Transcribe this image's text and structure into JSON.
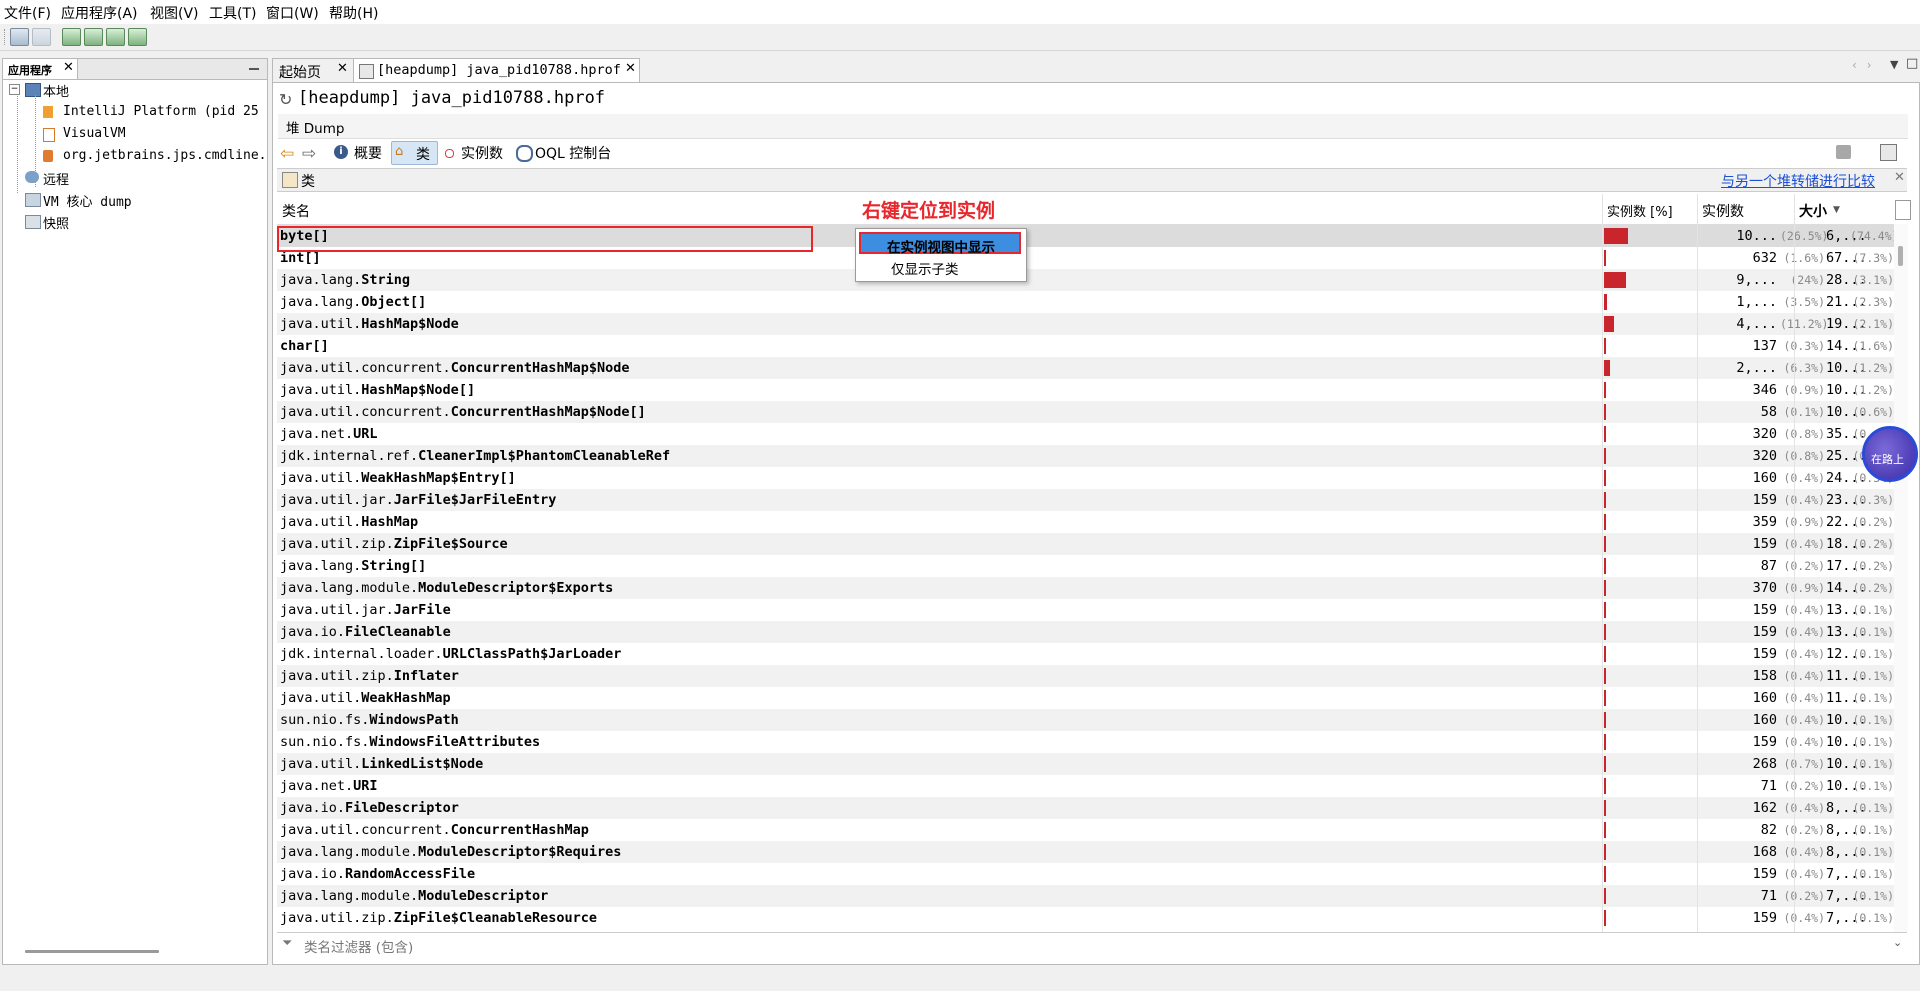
{
  "menu": [
    "文件(F)",
    "应用程序(A)",
    "视图(V)",
    "工具(T)",
    "窗口(W)",
    "帮助(H)"
  ],
  "left_panel": {
    "tab_label": "应用程序",
    "tree": {
      "local": "本地",
      "local_items": [
        "IntelliJ Platform (pid 25",
        "VisualVM",
        "org.jetbrains.jps.cmdline."
      ],
      "remote": "远程",
      "vm_core": "VM 核心 dump",
      "snapshots": "快照"
    }
  },
  "doc_tabs": [
    "起始页",
    "[heapdump] java_pid10788.hprof"
  ],
  "main": {
    "title": "[heapdump] java_pid10788.hprof",
    "heap_label": "堆 Dump",
    "nav": {
      "summary": "概要",
      "classes": "类",
      "instances": "实例数",
      "oql": "OQL 控制台"
    },
    "section_title": "类",
    "compare_link": "与另一个堆转储进行比较",
    "columns": {
      "class_name": "类名",
      "instances_pct": "实例数 [%]",
      "instances": "实例数",
      "size": "大小"
    },
    "filter_placeholder": "类名过滤器 (包含)"
  },
  "annotation": "右键定位到实例",
  "context_menu": {
    "item1": "在实例视图中显示",
    "item2": "仅显示子类"
  },
  "overlay_badge": "在路上",
  "colors": {
    "bar": "#c8262c",
    "annotation": "#e8262c",
    "selection": "#3d8ee0",
    "link": "#1a4fd6"
  },
  "rows": [
    {
      "pkg": "",
      "name": "byte[]",
      "pct_bar": 0.265,
      "count": "10...",
      "count_pct": "(26.5%)",
      "size": "6,...",
      "size_pct": "(74.4%)"
    },
    {
      "pkg": "",
      "name": "int[]",
      "pct_bar": 0.016,
      "count": "632",
      "count_pct": "(1.6%)",
      "size": "67...",
      "size_pct": "(7.3%)"
    },
    {
      "pkg": "java.lang.",
      "name": "String",
      "pct_bar": 0.24,
      "count": "9,...",
      "count_pct": "(24%)",
      "size": "28...",
      "size_pct": "(3.1%)"
    },
    {
      "pkg": "java.lang.",
      "name": "Object[]",
      "pct_bar": 0.035,
      "count": "1,...",
      "count_pct": "(3.5%)",
      "size": "21...",
      "size_pct": "(2.3%)"
    },
    {
      "pkg": "java.util.",
      "name": "HashMap$Node",
      "pct_bar": 0.112,
      "count": "4,...",
      "count_pct": "(11.2%)",
      "size": "19...",
      "size_pct": "(2.1%)"
    },
    {
      "pkg": "",
      "name": "char[]",
      "pct_bar": 0.003,
      "count": "137",
      "count_pct": "(0.3%)",
      "size": "14...",
      "size_pct": "(1.6%)"
    },
    {
      "pkg": "java.util.concurrent.",
      "name": "ConcurrentHashMap$Node",
      "pct_bar": 0.063,
      "count": "2,...",
      "count_pct": "(6.3%)",
      "size": "10...",
      "size_pct": "(1.2%)"
    },
    {
      "pkg": "java.util.",
      "name": "HashMap$Node[]",
      "pct_bar": 0.009,
      "count": "346",
      "count_pct": "(0.9%)",
      "size": "10...",
      "size_pct": "(1.2%)"
    },
    {
      "pkg": "java.util.concurrent.",
      "name": "ConcurrentHashMap$Node[]",
      "pct_bar": 0.001,
      "count": "58",
      "count_pct": "(0.1%)",
      "size": "10...",
      "size_pct": "(0.6%)"
    },
    {
      "pkg": "java.net.",
      "name": "URL",
      "pct_bar": 0.008,
      "count": "320",
      "count_pct": "(0.8%)",
      "size": "35...",
      "size_pct": "(0.4%)"
    },
    {
      "pkg": "jdk.internal.ref.",
      "name": "CleanerImpl$PhantomCleanableRef",
      "pct_bar": 0.008,
      "count": "320",
      "count_pct": "(0.8%)",
      "size": "25...",
      "size_pct": "(0.3%)"
    },
    {
      "pkg": "java.util.",
      "name": "WeakHashMap$Entry[]",
      "pct_bar": 0.004,
      "count": "160",
      "count_pct": "(0.4%)",
      "size": "24...",
      "size_pct": "(0.3%)"
    },
    {
      "pkg": "java.util.jar.",
      "name": "JarFile$JarFileEntry",
      "pct_bar": 0.004,
      "count": "159",
      "count_pct": "(0.4%)",
      "size": "23...",
      "size_pct": "(0.3%)"
    },
    {
      "pkg": "java.util.",
      "name": "HashMap",
      "pct_bar": 0.009,
      "count": "359",
      "count_pct": "(0.9%)",
      "size": "22...",
      "size_pct": "(0.2%)"
    },
    {
      "pkg": "java.util.zip.",
      "name": "ZipFile$Source",
      "pct_bar": 0.004,
      "count": "159",
      "count_pct": "(0.4%)",
      "size": "18...",
      "size_pct": "(0.2%)"
    },
    {
      "pkg": "java.lang.",
      "name": "String[]",
      "pct_bar": 0.002,
      "count": "87",
      "count_pct": "(0.2%)",
      "size": "17...",
      "size_pct": "(0.2%)"
    },
    {
      "pkg": "java.lang.module.",
      "name": "ModuleDescriptor$Exports",
      "pct_bar": 0.009,
      "count": "370",
      "count_pct": "(0.9%)",
      "size": "14...",
      "size_pct": "(0.2%)"
    },
    {
      "pkg": "java.util.jar.",
      "name": "JarFile",
      "pct_bar": 0.004,
      "count": "159",
      "count_pct": "(0.4%)",
      "size": "13...",
      "size_pct": "(0.1%)"
    },
    {
      "pkg": "java.io.",
      "name": "FileCleanable",
      "pct_bar": 0.004,
      "count": "159",
      "count_pct": "(0.4%)",
      "size": "13...",
      "size_pct": "(0.1%)"
    },
    {
      "pkg": "jdk.internal.loader.",
      "name": "URLClassPath$JarLoader",
      "pct_bar": 0.004,
      "count": "159",
      "count_pct": "(0.4%)",
      "size": "12...",
      "size_pct": "(0.1%)"
    },
    {
      "pkg": "java.util.zip.",
      "name": "Inflater",
      "pct_bar": 0.004,
      "count": "158",
      "count_pct": "(0.4%)",
      "size": "11...",
      "size_pct": "(0.1%)"
    },
    {
      "pkg": "java.util.",
      "name": "WeakHashMap",
      "pct_bar": 0.004,
      "count": "160",
      "count_pct": "(0.4%)",
      "size": "11...",
      "size_pct": "(0.1%)"
    },
    {
      "pkg": "sun.nio.fs.",
      "name": "WindowsPath",
      "pct_bar": 0.004,
      "count": "160",
      "count_pct": "(0.4%)",
      "size": "10...",
      "size_pct": "(0.1%)"
    },
    {
      "pkg": "sun.nio.fs.",
      "name": "WindowsFileAttributes",
      "pct_bar": 0.004,
      "count": "159",
      "count_pct": "(0.4%)",
      "size": "10...",
      "size_pct": "(0.1%)"
    },
    {
      "pkg": "java.util.",
      "name": "LinkedList$Node",
      "pct_bar": 0.007,
      "count": "268",
      "count_pct": "(0.7%)",
      "size": "10...",
      "size_pct": "(0.1%)"
    },
    {
      "pkg": "java.net.",
      "name": "URI",
      "pct_bar": 0.002,
      "count": "71",
      "count_pct": "(0.2%)",
      "size": "10...",
      "size_pct": "(0.1%)"
    },
    {
      "pkg": "java.io.",
      "name": "FileDescriptor",
      "pct_bar": 0.004,
      "count": "162",
      "count_pct": "(0.4%)",
      "size": "8,...",
      "size_pct": "(0.1%)"
    },
    {
      "pkg": "java.util.concurrent.",
      "name": "ConcurrentHashMap",
      "pct_bar": 0.002,
      "count": "82",
      "count_pct": "(0.2%)",
      "size": "8,...",
      "size_pct": "(0.1%)"
    },
    {
      "pkg": "java.lang.module.",
      "name": "ModuleDescriptor$Requires",
      "pct_bar": 0.004,
      "count": "168",
      "count_pct": "(0.4%)",
      "size": "8,...",
      "size_pct": "(0.1%)"
    },
    {
      "pkg": "java.io.",
      "name": "RandomAccessFile",
      "pct_bar": 0.004,
      "count": "159",
      "count_pct": "(0.4%)",
      "size": "7,...",
      "size_pct": "(0.1%)"
    },
    {
      "pkg": "java.lang.module.",
      "name": "ModuleDescriptor",
      "pct_bar": 0.002,
      "count": "71",
      "count_pct": "(0.2%)",
      "size": "7,...",
      "size_pct": "(0.1%)"
    },
    {
      "pkg": "java.util.zip.",
      "name": "ZipFile$CleanableResource",
      "pct_bar": 0.004,
      "count": "159",
      "count_pct": "(0.4%)",
      "size": "7,...",
      "size_pct": "(0.1%)"
    }
  ]
}
